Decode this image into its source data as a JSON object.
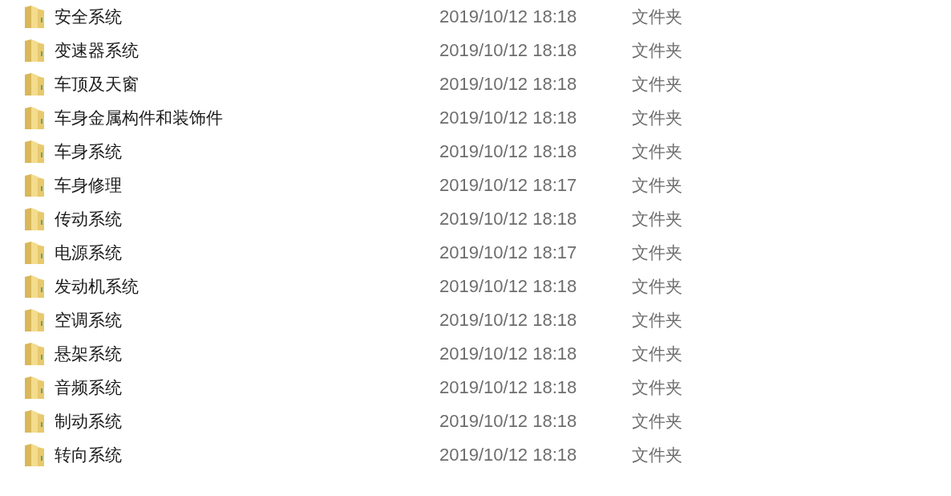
{
  "files": [
    {
      "name": "安全系统",
      "modified": "2019/10/12 18:18",
      "type": "文件夹"
    },
    {
      "name": "变速器系统",
      "modified": "2019/10/12 18:18",
      "type": "文件夹"
    },
    {
      "name": "车顶及天窗",
      "modified": "2019/10/12 18:18",
      "type": "文件夹"
    },
    {
      "name": "车身金属构件和装饰件",
      "modified": "2019/10/12 18:18",
      "type": "文件夹"
    },
    {
      "name": "车身系统",
      "modified": "2019/10/12 18:18",
      "type": "文件夹"
    },
    {
      "name": "车身修理",
      "modified": "2019/10/12 18:17",
      "type": "文件夹"
    },
    {
      "name": "传动系统",
      "modified": "2019/10/12 18:18",
      "type": "文件夹"
    },
    {
      "name": "电源系统",
      "modified": "2019/10/12 18:17",
      "type": "文件夹"
    },
    {
      "name": "发动机系统",
      "modified": "2019/10/12 18:18",
      "type": "文件夹"
    },
    {
      "name": "空调系统",
      "modified": "2019/10/12 18:18",
      "type": "文件夹"
    },
    {
      "name": "悬架系统",
      "modified": "2019/10/12 18:18",
      "type": "文件夹"
    },
    {
      "name": "音频系统",
      "modified": "2019/10/12 18:18",
      "type": "文件夹"
    },
    {
      "name": "制动系统",
      "modified": "2019/10/12 18:18",
      "type": "文件夹"
    },
    {
      "name": "转向系统",
      "modified": "2019/10/12 18:18",
      "type": "文件夹"
    }
  ]
}
